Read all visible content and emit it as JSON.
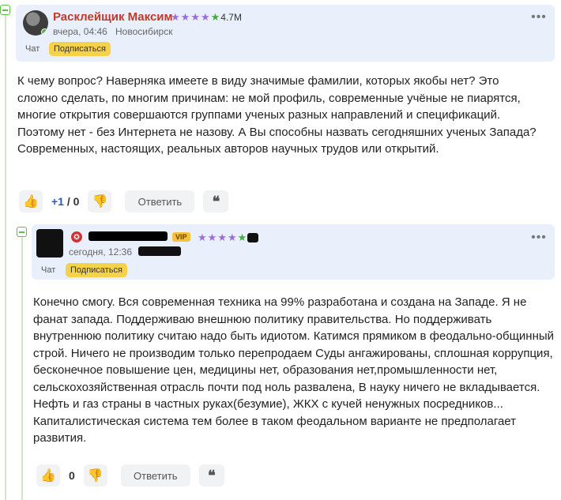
{
  "comment1": {
    "author": "Расклейщик Максим",
    "rating": "4.7M",
    "date": "вчера, 04:46",
    "city": "Новосибирск",
    "chat_label": "Чат",
    "subscribe_label": "Подписаться",
    "text": "К чему вопрос? Наверняка имеете в виду значимые фамилии, которых якобы нет? Это сложно сделать, по многим причинам: не мой профиль, современные учёные не пиарятся, многие открытия совершаются группами ученых разных направлений и спецификаций. Поэтому нет - без Интернета не назову. А Вы способны назвать сегодняшних ученых Запада? Современных, настоящих, реальных авторов научных трудов или открытий.",
    "score_plus": "+1",
    "score_sep": " / ",
    "score_minus": "0",
    "reply_label": "Ответить",
    "quote_symbol": "❝"
  },
  "comment2": {
    "date": "сегодня, 12:36",
    "vip": "VIP",
    "chat_label": "Чат",
    "subscribe_label": "Подписаться",
    "text": "Конечно смогу. Вся современная техника на 99% разработана и создана на Западе. Я не фанат запада. Поддерживаю внешнюю политику правительства. Но поддерживать внутреннюю политику считаю надо быть идиотом. Катимся прямиком в феодально-общинный строй. Ничего не производим только перепродаем Суды ангажированы, сплошная коррупция, бесконечное повышение цен, медицины нет, образования нет,промышленности нет, сельскохозяйственная отрасль почти под ноль развалена, В науку ничего не вкладывается. Нефть и газ страны в частных руках(безумие), ЖКХ с кучей ненужных посредников... Капиталистическая система тем более в таком феодальном варианте не предполагает развития.",
    "score": "0",
    "reply_label": "Ответить",
    "quote_symbol": "❝"
  },
  "icons": {
    "like": "👍",
    "dislike": "👎",
    "more": "•••",
    "star": "★"
  },
  "colors": {
    "accent_green": "#5fbf4a",
    "header_bg": "#e9f0fb",
    "author_red": "#c0392b",
    "subscribe_yellow": "#f6d24a",
    "like_orange": "#f0a524"
  }
}
